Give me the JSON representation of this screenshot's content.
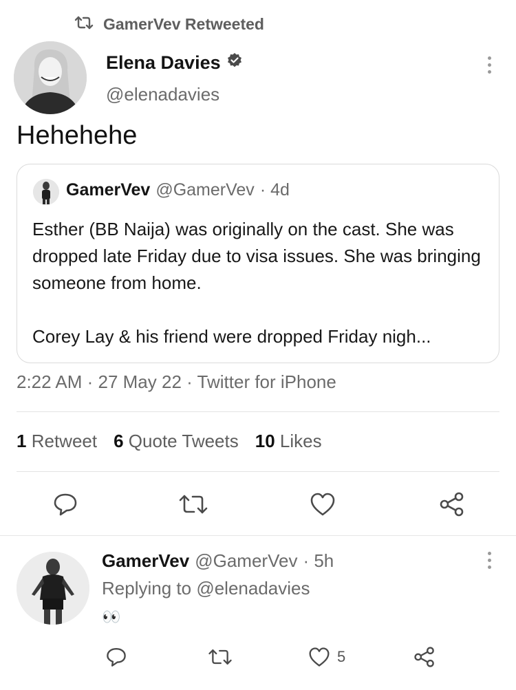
{
  "retweet_header": {
    "text": "GamerVev Retweeted"
  },
  "tweet": {
    "author": {
      "name": "Elena Davies",
      "handle": "@elenadavies",
      "verified": true
    },
    "text": "Hehehehe",
    "quoted": {
      "author_name": "GamerVev",
      "author_handle": "@GamerVev",
      "time": "· 4d",
      "paragraph1": "Esther (BB Naija) was originally on the cast. She was dropped late Friday due to visa issues. She was bringing someone from home.",
      "paragraph2": "Corey Lay & his friend were dropped Friday nigh..."
    },
    "meta": "2:22 AM · 27 May 22 · Twitter for iPhone",
    "stats": {
      "retweets_count": "1",
      "retweets_label": "Retweet",
      "quotes_count": "6",
      "quotes_label": "Quote Tweets",
      "likes_count": "10",
      "likes_label": "Likes"
    }
  },
  "reply": {
    "author_name": "GamerVev",
    "author_handle": "@GamerVev",
    "time": "· 5h",
    "replying_prefix": "Replying to",
    "replying_to": "@elenadavies",
    "text": "👀",
    "likes_count": "5"
  },
  "icons": {
    "retweet_header": "retweet-icon",
    "verified": "verified-badge-icon",
    "more": "more-vertical-icon",
    "reply": "reply-icon",
    "retweet": "retweet-icon",
    "like": "heart-icon",
    "share": "share-icon"
  },
  "colors": {
    "text": "#141414",
    "muted": "#6b6b6b",
    "divider": "#e3e3e3"
  }
}
